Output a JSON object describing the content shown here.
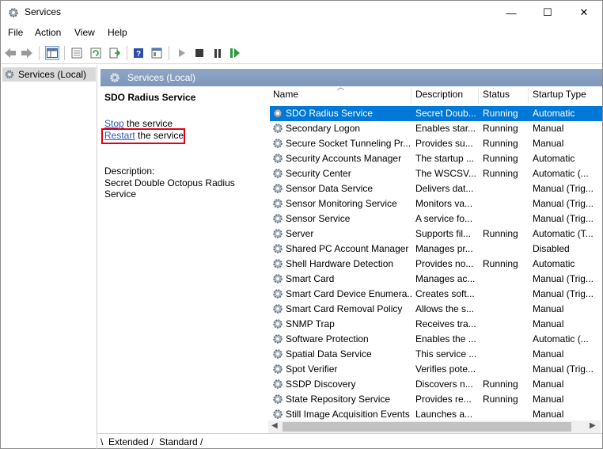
{
  "window": {
    "title": "Services",
    "minimize_glyph": "—",
    "maximize_glyph": "☐",
    "close_glyph": "✕"
  },
  "menu": [
    "File",
    "Action",
    "View",
    "Help"
  ],
  "tree": {
    "item": "Services (Local)"
  },
  "panel": {
    "header": "Services (Local)",
    "service_name": "SDO Radius Service",
    "stop_link": "Stop",
    "stop_rest": " the service",
    "restart_link": "Restart",
    "restart_rest": " the service",
    "description_label": "Description:",
    "description_text": "Secret Double Octopus Radius Service"
  },
  "columns": {
    "name": "Name",
    "description": "Description",
    "status": "Status",
    "startup": "Startup Type"
  },
  "rows": [
    {
      "name": "SDO Radius Service",
      "description": "Secret Doub...",
      "status": "Running",
      "startup": "Automatic",
      "selected": true
    },
    {
      "name": "Secondary Logon",
      "description": "Enables star...",
      "status": "Running",
      "startup": "Manual"
    },
    {
      "name": "Secure Socket Tunneling Pr...",
      "description": "Provides su...",
      "status": "Running",
      "startup": "Manual"
    },
    {
      "name": "Security Accounts Manager",
      "description": "The startup ...",
      "status": "Running",
      "startup": "Automatic"
    },
    {
      "name": "Security Center",
      "description": "The WSCSV...",
      "status": "Running",
      "startup": "Automatic (..."
    },
    {
      "name": "Sensor Data Service",
      "description": "Delivers dat...",
      "status": "",
      "startup": "Manual (Trig..."
    },
    {
      "name": "Sensor Monitoring Service",
      "description": "Monitors va...",
      "status": "",
      "startup": "Manual (Trig..."
    },
    {
      "name": "Sensor Service",
      "description": "A service fo...",
      "status": "",
      "startup": "Manual (Trig..."
    },
    {
      "name": "Server",
      "description": "Supports fil...",
      "status": "Running",
      "startup": "Automatic (T..."
    },
    {
      "name": "Shared PC Account Manager",
      "description": "Manages pr...",
      "status": "",
      "startup": "Disabled"
    },
    {
      "name": "Shell Hardware Detection",
      "description": "Provides no...",
      "status": "Running",
      "startup": "Automatic"
    },
    {
      "name": "Smart Card",
      "description": "Manages ac...",
      "status": "",
      "startup": "Manual (Trig..."
    },
    {
      "name": "Smart Card Device Enumera...",
      "description": "Creates soft...",
      "status": "",
      "startup": "Manual (Trig..."
    },
    {
      "name": "Smart Card Removal Policy",
      "description": "Allows the s...",
      "status": "",
      "startup": "Manual"
    },
    {
      "name": "SNMP Trap",
      "description": "Receives tra...",
      "status": "",
      "startup": "Manual"
    },
    {
      "name": "Software Protection",
      "description": "Enables the ...",
      "status": "",
      "startup": "Automatic (..."
    },
    {
      "name": "Spatial Data Service",
      "description": "This service ...",
      "status": "",
      "startup": "Manual"
    },
    {
      "name": "Spot Verifier",
      "description": "Verifies pote...",
      "status": "",
      "startup": "Manual (Trig..."
    },
    {
      "name": "SSDP Discovery",
      "description": "Discovers n...",
      "status": "Running",
      "startup": "Manual"
    },
    {
      "name": "State Repository Service",
      "description": "Provides re...",
      "status": "Running",
      "startup": "Manual"
    },
    {
      "name": "Still Image Acquisition Events",
      "description": "Launches a...",
      "status": "",
      "startup": "Manual"
    }
  ],
  "tabs": [
    "Extended",
    "Standard"
  ],
  "colors": {
    "selection": "#0078d7",
    "header": "#7d97bb",
    "highlight_box": "#e0001a",
    "link": "#2a5ab8"
  }
}
